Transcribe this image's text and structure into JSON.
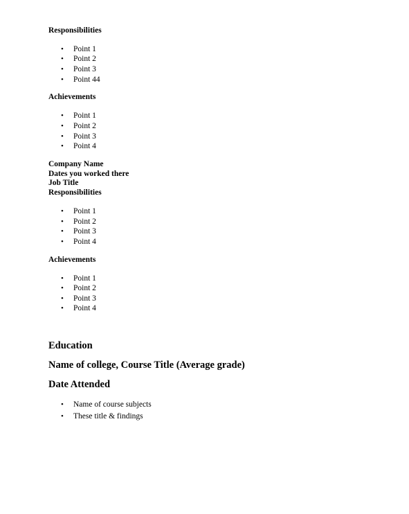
{
  "job1": {
    "responsibilities_heading": "Responsibilities",
    "responsibilities": [
      "Point 1",
      "Point 2",
      "Point 3",
      "Point 44"
    ],
    "achievements_heading": "Achievements",
    "achievements": [
      "Point 1",
      "Point 2",
      "Point 3",
      "Point 4"
    ]
  },
  "job2": {
    "company": "Company Name",
    "dates": "Dates you worked there",
    "job_title": "Job Title",
    "responsibilities_heading": "Responsibilities",
    "responsibilities": [
      "Point 1",
      "Point 2",
      "Point 3",
      "Point 4"
    ],
    "achievements_heading": "Achievements",
    "achievements": [
      "Point 1",
      "Point 2",
      "Point 3",
      "Point 4"
    ]
  },
  "education": {
    "heading": "Education",
    "college": "Name of college, Course Title (Average grade)",
    "date": "Date Attended",
    "items": [
      "Name of course subjects",
      "These title & findings"
    ]
  },
  "bullet_glyph": "•"
}
